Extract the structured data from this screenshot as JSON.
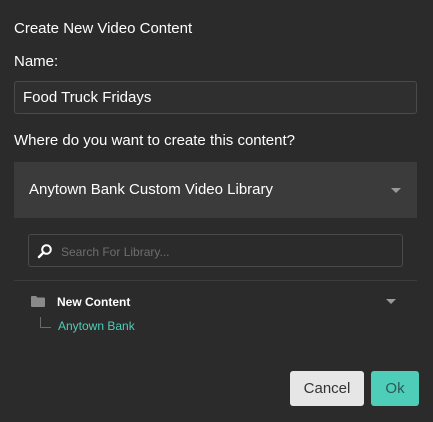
{
  "dialog": {
    "title": "Create New Video Content",
    "name_label": "Name:",
    "name_value": "Food Truck Fridays",
    "question": "Where do you want to create this content?",
    "library_selected": "Anytown Bank Custom Video Library",
    "search_placeholder": "Search For Library...",
    "tree": {
      "folder_label": "New Content",
      "child_label": "Anytown Bank"
    },
    "buttons": {
      "cancel": "Cancel",
      "ok": "Ok"
    }
  },
  "colors": {
    "background": "#2b2b2b",
    "accent": "#4ecdb8"
  },
  "icons": [
    "search-icon",
    "folder-icon",
    "caret-down-icon"
  ]
}
